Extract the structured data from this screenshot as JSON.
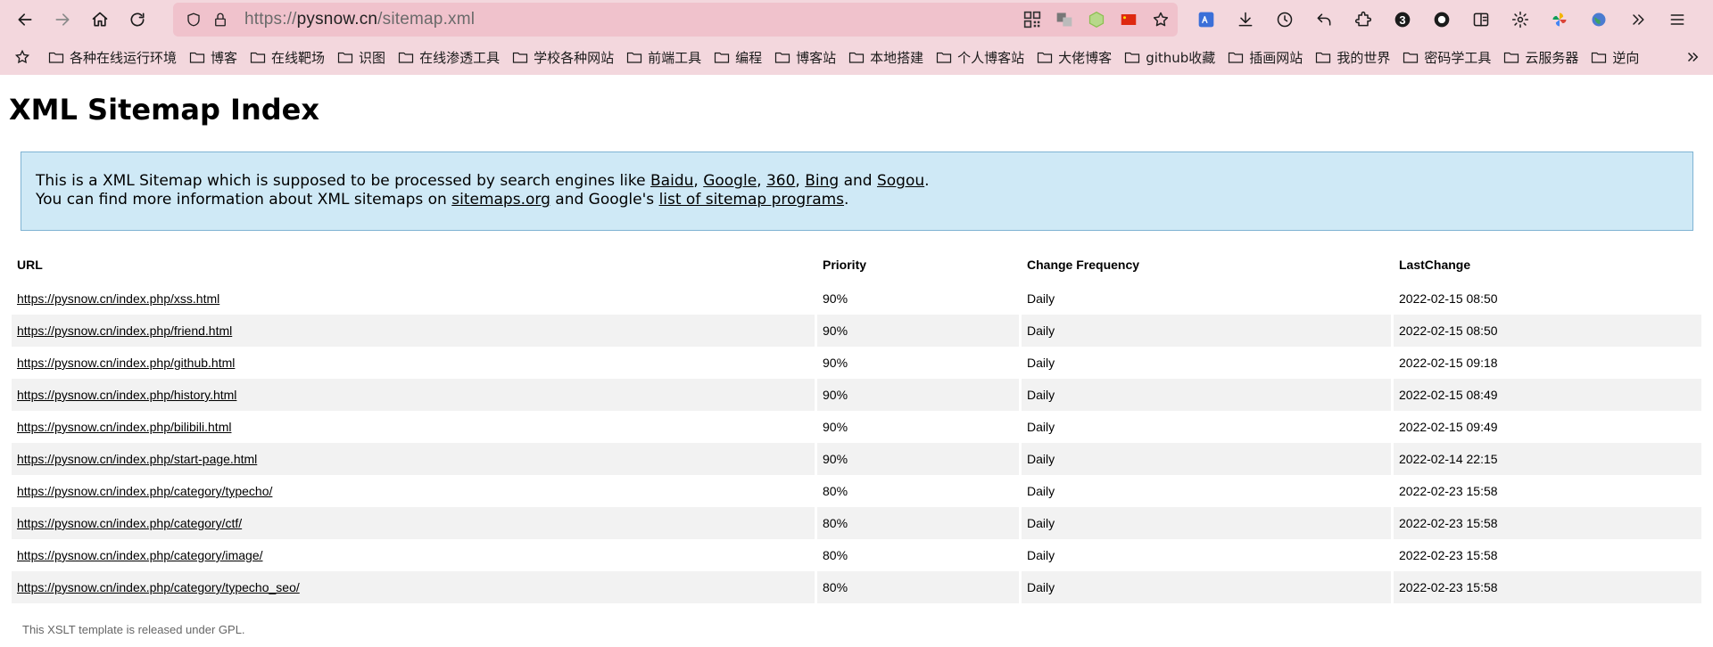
{
  "browser": {
    "url_scheme": "https://",
    "url_host": "pysnow.cn",
    "url_path": "/sitemap.xml",
    "extension_badge": "3"
  },
  "bookmarks": [
    "各种在线运行环境",
    "博客",
    "在线靶场",
    "识图",
    "在线渗透工具",
    "学校各种网站",
    "前端工具",
    "编程",
    "博客站",
    "本地搭建",
    "个人博客站",
    "大佬博客",
    "github收藏",
    "插画网站",
    "我的世界",
    "密码学工具",
    "云服务器",
    "逆向"
  ],
  "page": {
    "title": "XML Sitemap Index",
    "intro_line1_prefix": "This is a XML Sitemap which is supposed to be processed by search engines like ",
    "links_engines": [
      "Baidu",
      "Google",
      "360",
      "Bing",
      "Sogou"
    ],
    "intro_and": " and ",
    "intro_line1_suffix": ".",
    "intro_line2_prefix": "You can find more information about XML sitemaps on ",
    "link_sitemaps": "sitemaps.org",
    "intro_line2_mid": " and Google's ",
    "link_programs": "list of sitemap programs",
    "intro_line2_suffix": ".",
    "footer": "This XSLT template is released under GPL."
  },
  "table": {
    "headers": [
      "URL",
      "Priority",
      "Change Frequency",
      "LastChange"
    ],
    "rows": [
      [
        "https://pysnow.cn/index.php/xss.html",
        "90%",
        "Daily",
        "2022-02-15 08:50"
      ],
      [
        "https://pysnow.cn/index.php/friend.html",
        "90%",
        "Daily",
        "2022-02-15 08:50"
      ],
      [
        "https://pysnow.cn/index.php/github.html",
        "90%",
        "Daily",
        "2022-02-15 09:18"
      ],
      [
        "https://pysnow.cn/index.php/history.html",
        "90%",
        "Daily",
        "2022-02-15 08:49"
      ],
      [
        "https://pysnow.cn/index.php/bilibili.html",
        "90%",
        "Daily",
        "2022-02-15 09:49"
      ],
      [
        "https://pysnow.cn/index.php/start-page.html",
        "90%",
        "Daily",
        "2022-02-14 22:15"
      ],
      [
        "https://pysnow.cn/index.php/category/typecho/",
        "80%",
        "Daily",
        "2022-02-23 15:58"
      ],
      [
        "https://pysnow.cn/index.php/category/ctf/",
        "80%",
        "Daily",
        "2022-02-23 15:58"
      ],
      [
        "https://pysnow.cn/index.php/category/image/",
        "80%",
        "Daily",
        "2022-02-23 15:58"
      ],
      [
        "https://pysnow.cn/index.php/category/typecho_seo/",
        "80%",
        "Daily",
        "2022-02-23 15:58"
      ]
    ]
  }
}
